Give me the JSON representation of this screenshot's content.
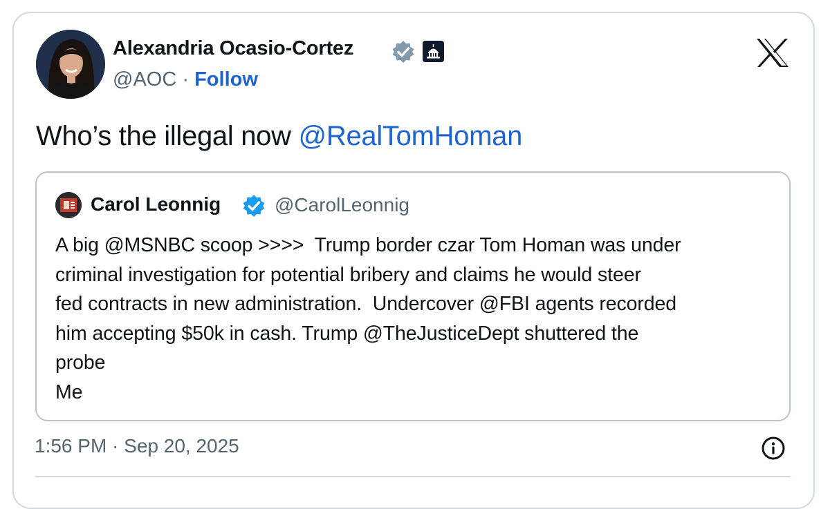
{
  "author": {
    "name": "Alexandria Ocasio-Cortez",
    "handle": "@AOC",
    "separator": " · ",
    "follow_label": "Follow"
  },
  "tweet": {
    "text": "Who’s the illegal now ",
    "mention": "@RealTomHoman"
  },
  "quote": {
    "name": "Carol Leonnig",
    "handle": "@CarolLeonnig",
    "lines": [
      "A big @MSNBC scoop >>>>  Trump border czar Tom Homan was under",
      "criminal investigation for potential bribery and claims he would steer",
      "fed contracts in new administration.  Undercover @FBI agents recorded",
      "him accepting $50k in cash. Trump @TheJusticeDept shuttered the",
      "probe",
      "Me"
    ]
  },
  "timestamp": "1:56 PM · Sep 20, 2025",
  "icons": {
    "brand": "x-logo-icon",
    "author_verified": "verified-gray-icon",
    "government": "capitol-building-icon",
    "quote_verified": "verified-blue-icon",
    "info": "info-icon"
  },
  "colors": {
    "link": "#1d63d1",
    "secondary_text": "#536471",
    "verified_blue": "#1d9bf0",
    "verified_gray": "#829aab",
    "border": "#cfd9de"
  }
}
